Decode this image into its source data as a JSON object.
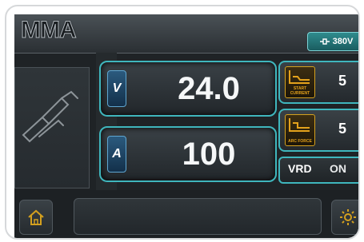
{
  "header": {
    "mode": "MMA",
    "voltage": "380V",
    "voltage_icon": "power-plug-icon"
  },
  "voltage_display": {
    "unit": "V",
    "value": "24.0"
  },
  "current_display": {
    "unit": "A",
    "value": "100"
  },
  "params": [
    {
      "label": "START CURRENT",
      "value": "5",
      "icon": "start-current-icon"
    },
    {
      "label": "ARC FORCE",
      "value": "5",
      "icon": "arc-force-icon"
    }
  ],
  "vrd": {
    "label": "VRD",
    "state": "ON"
  },
  "colors": {
    "accent": "#3fb6bd",
    "param_icon": "#d4a01e",
    "background": "#1f2326"
  }
}
